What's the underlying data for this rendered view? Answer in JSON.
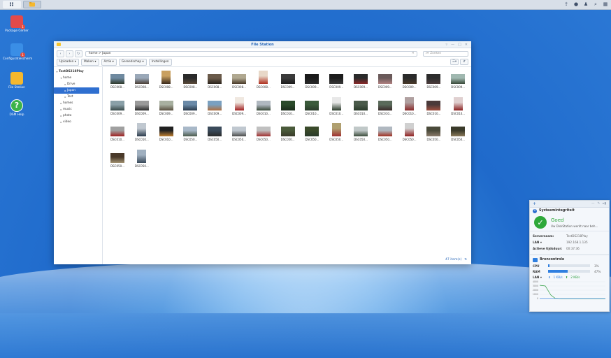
{
  "taskbar": {
    "apps_icon": "grid-icon",
    "filestation_icon": "folder-icon",
    "right_icons": [
      "upload-icon",
      "chat-icon",
      "user-icon",
      "search-icon",
      "widget-icon"
    ]
  },
  "desktop": {
    "icons": [
      {
        "label": "Package Center",
        "badge": "1",
        "icon": "package-icon",
        "color": "#e24a4a"
      },
      {
        "label": "Configuratiescherm",
        "badge": "1",
        "icon": "control-panel-icon",
        "color": "#3a8ee6"
      },
      {
        "label": "File Station",
        "badge": "",
        "icon": "folder-icon",
        "color": "#f5b82e"
      },
      {
        "label": "DSM Help",
        "badge": "",
        "icon": "help-icon",
        "color": "#3cb34a"
      }
    ]
  },
  "window": {
    "title": "File Station",
    "path": "home > Japan",
    "search_placeholder": "Zoeken",
    "toolbar": [
      "Uploaden ▾",
      "Maken ▾",
      "Actie ▾",
      "Gereedschap ▾",
      "Instellingen"
    ],
    "tree": [
      {
        "label": "TestDS218Play",
        "level": 0,
        "caret": "▾",
        "root": true
      },
      {
        "label": "home",
        "level": 1,
        "caret": "▾"
      },
      {
        "label": "Drive",
        "level": 2,
        "caret": "▸"
      },
      {
        "label": "Japan",
        "level": 2,
        "caret": "▸",
        "selected": true
      },
      {
        "label": "Test",
        "level": 2,
        "caret": "▸"
      },
      {
        "label": "homes",
        "level": 1,
        "caret": "▸"
      },
      {
        "label": "music",
        "level": 1,
        "caret": "▸"
      },
      {
        "label": "photo",
        "level": 1,
        "caret": "▸"
      },
      {
        "label": "video",
        "level": 1,
        "caret": "▸"
      }
    ],
    "files": [
      {
        "name": "DSC008...",
        "c1": "#6f8aa0",
        "c2": "#2e3a2c",
        "portrait": false
      },
      {
        "name": "DSC008...",
        "c1": "#9aa8b8",
        "c2": "#4b4036",
        "portrait": false
      },
      {
        "name": "DSC008...",
        "c1": "#c9a060",
        "c2": "#3b2a1c",
        "portrait": true
      },
      {
        "name": "DSC008...",
        "c1": "#2a2a2a",
        "c2": "#5a4a3a",
        "portrait": false
      },
      {
        "name": "DSC008...",
        "c1": "#6a5a4a",
        "c2": "#2a231c",
        "portrait": false
      },
      {
        "name": "DSC008...",
        "c1": "#b0a890",
        "c2": "#4a3b2a",
        "portrait": false
      },
      {
        "name": "DSC008...",
        "c1": "#e8d8c8",
        "c2": "#b03020",
        "portrait": true
      },
      {
        "name": "DSC009...",
        "c1": "#3a3a3a",
        "c2": "#1c1c1c",
        "portrait": false
      },
      {
        "name": "DSC009...",
        "c1": "#1a1a1a",
        "c2": "#2a2a2a",
        "portrait": false
      },
      {
        "name": "DSC009...",
        "c1": "#1c1c1c",
        "c2": "#3a3a3a",
        "portrait": false
      },
      {
        "name": "DSC009...",
        "c1": "#2a2a2a",
        "c2": "#8a2a2a",
        "portrait": false
      },
      {
        "name": "DSC009...",
        "c1": "#6a5a5a",
        "c2": "#b08080",
        "portrait": false
      },
      {
        "name": "DSC009...",
        "c1": "#2a2a2a",
        "c2": "#4a3a2a",
        "portrait": false
      },
      {
        "name": "DSC009...",
        "c1": "#2c2c2c",
        "c2": "#4c3c3c",
        "portrait": false
      },
      {
        "name": "DSC009...",
        "c1": "#a0b8b0",
        "c2": "#3a4a3a",
        "portrait": false
      },
      {
        "name": "DSC009...",
        "c1": "#8aa0a8",
        "c2": "#3a4a4a",
        "portrait": false
      },
      {
        "name": "DSC009...",
        "c1": "#9a9a9a",
        "c2": "#2c2c2c",
        "portrait": false
      },
      {
        "name": "DSC009...",
        "c1": "#a8b0a0",
        "c2": "#5a5040",
        "portrait": false
      },
      {
        "name": "DSC009...",
        "c1": "#6a8aa8",
        "c2": "#2a3a4a",
        "portrait": false
      },
      {
        "name": "DSC009...",
        "c1": "#7aa0c0",
        "c2": "#b07040",
        "portrait": false
      },
      {
        "name": "DSC009...",
        "c1": "#f0e8e0",
        "c2": "#a02020",
        "portrait": true
      },
      {
        "name": "DSC010...",
        "c1": "#b0b8c0",
        "c2": "#3a4a3a",
        "portrait": false
      },
      {
        "name": "DSC010...",
        "c1": "#2a4a2a",
        "c2": "#1a2a1a",
        "portrait": false
      },
      {
        "name": "DSC010...",
        "c1": "#3a5a3a",
        "c2": "#2a3a2a",
        "portrait": false
      },
      {
        "name": "DSC010...",
        "c1": "#e8e8e8",
        "c2": "#2a3a2a",
        "portrait": true
      },
      {
        "name": "DSC010...",
        "c1": "#4a5a4a",
        "c2": "#2a3a2a",
        "portrait": false
      },
      {
        "name": "DSC010...",
        "c1": "#5a6a5a",
        "c2": "#3a2a2a",
        "portrait": false
      },
      {
        "name": "DSC010...",
        "c1": "#b0a0a0",
        "c2": "#8a2a2a",
        "portrait": true
      },
      {
        "name": "DSC010...",
        "c1": "#4a3a3a",
        "c2": "#a05040",
        "portrait": false
      },
      {
        "name": "DSC010...",
        "c1": "#e0d0d0",
        "c2": "#8a2020",
        "portrait": true
      },
      {
        "name": "DSC010...",
        "c1": "#a0a0a0",
        "c2": "#a02020",
        "portrait": false
      },
      {
        "name": "DSC010...",
        "c1": "#c0c8d0",
        "c2": "#2a3a4a",
        "portrait": true
      },
      {
        "name": "DSC010...",
        "c1": "#202020",
        "c2": "#c08030",
        "portrait": false
      },
      {
        "name": "DSC050...",
        "c1": "#a8b8c8",
        "c2": "#4a5a4a",
        "portrait": false
      },
      {
        "name": "DSC050...",
        "c1": "#3a4a5a",
        "c2": "#2a2a2a",
        "portrait": false
      },
      {
        "name": "DSC050...",
        "c1": "#c0c8d0",
        "c2": "#4a4a4a",
        "portrait": false
      },
      {
        "name": "DSC050...",
        "c1": "#c0c0c0",
        "c2": "#a03030",
        "portrait": false
      },
      {
        "name": "DSC050...",
        "c1": "#4a5a3a",
        "c2": "#3a3a2a",
        "portrait": false
      },
      {
        "name": "DSC050...",
        "c1": "#3a4a2a",
        "c2": "#2a3a2a",
        "portrait": false
      },
      {
        "name": "DSC050...",
        "c1": "#b0a070",
        "c2": "#a03030",
        "portrait": true
      },
      {
        "name": "DSC050...",
        "c1": "#c0c8c8",
        "c2": "#3a4a3a",
        "portrait": false
      },
      {
        "name": "DSC050...",
        "c1": "#b0b8c0",
        "c2": "#a03020",
        "portrait": false
      },
      {
        "name": "DSC050...",
        "c1": "#d0d0d0",
        "c2": "#902020",
        "portrait": true
      },
      {
        "name": "DSC050...",
        "c1": "#4a4a3a",
        "c2": "#8a7a6a",
        "portrait": false
      },
      {
        "name": "DSC050...",
        "c1": "#3a3a2a",
        "c2": "#8a7a5a",
        "portrait": false
      },
      {
        "name": "DSC050...",
        "c1": "#4a3a2a",
        "c2": "#a09070",
        "portrait": false
      },
      {
        "name": "DSC050...",
        "c1": "#a0b0c0",
        "c2": "#3a4a5a",
        "portrait": true
      }
    ],
    "status_count": "47 item(s)"
  },
  "widget": {
    "section1_title": "Systeemintegriteit",
    "status_title": "Goed",
    "status_sub": "Uw DiskStation werkt naar beh...",
    "server_label": "Servernaam:",
    "server_value": "TestDS218Play",
    "lan_label": "LAN ▾",
    "lan_value": "192.168.1.135",
    "uptime_label": "Actieve tijdsduur:",
    "uptime_value": "00:37:36",
    "section2_title": "Broncontrole",
    "cpu_label": "CPU",
    "cpu_pct": 3,
    "cpu_text": "3%",
    "ram_label": "RAM",
    "ram_pct": 47,
    "ram_text": "47%",
    "lan2_label": "LAN ▾",
    "up_text": "1 KB/s",
    "down_text": "2 KB/s",
    "y_ticks": [
      "4000",
      "3000",
      "2000",
      "1000",
      "0"
    ]
  }
}
